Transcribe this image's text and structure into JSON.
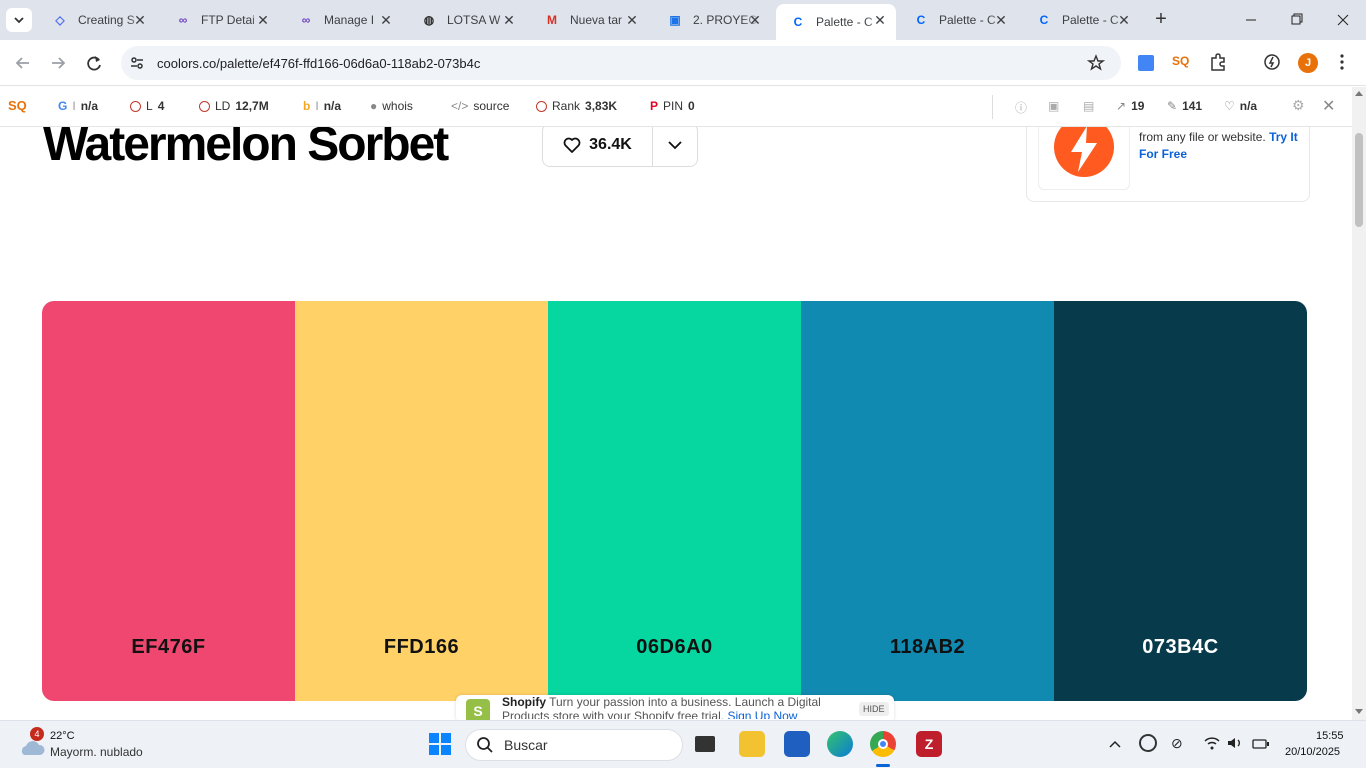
{
  "browser": {
    "tabs": [
      {
        "title": "Creating S",
        "icon": "webflow-icon",
        "color": "#4c6ef5"
      },
      {
        "title": "FTP Detai",
        "icon": "infinity-icon",
        "color": "#6f42c1"
      },
      {
        "title": "Manage I",
        "icon": "infinity-icon",
        "color": "#6f42c1"
      },
      {
        "title": "LOTSA W",
        "icon": "globe-icon",
        "color": "#333333"
      },
      {
        "title": "Nueva tar",
        "icon": "gmail-icon",
        "color": "#d93025"
      },
      {
        "title": "2. PROYEC",
        "icon": "contacts-icon",
        "color": "#1a73e8"
      },
      {
        "title": "Palette - C",
        "icon": "coolors-icon",
        "color": "#0066ff"
      },
      {
        "title": "Palette - C",
        "icon": "coolors-icon",
        "color": "#0066ff"
      },
      {
        "title": "Palette - C",
        "icon": "coolors-icon",
        "color": "#0066ff"
      }
    ],
    "url": "coolors.co/palette/ef476f-ffd166-06d6a0-118ab2-073b4c",
    "profile_initial": "J",
    "seo_badge": "SQ"
  },
  "extbar": {
    "google": "n/a",
    "links_label": "L",
    "links": "4",
    "ld_label": "LD",
    "ld": "12,7M",
    "bing": "n/a",
    "whois": "whois",
    "source": "source",
    "rank_label": "Rank",
    "rank": "3,83K",
    "pin_label": "PIN",
    "pin": "0",
    "ext_links": "19",
    "int_links": "141",
    "health": "n/a"
  },
  "page": {
    "title": "Watermelon Sorbet",
    "likes": "36.4K",
    "ad": {
      "text": "chatbot trained with your data from any file or website.",
      "cta": "Try It For Free"
    },
    "swatches": [
      {
        "hex": "EF476F",
        "color": "#EF476F",
        "text_color": "#111111"
      },
      {
        "hex": "FFD166",
        "color": "#FFD166",
        "text_color": "#111111"
      },
      {
        "hex": "06D6A0",
        "color": "#06D6A0",
        "text_color": "#111111"
      },
      {
        "hex": "118AB2",
        "color": "#118AB2",
        "text_color": "#111111"
      },
      {
        "hex": "073B4C",
        "color": "#073B4C",
        "text_color": "#ffffff"
      }
    ],
    "shopify": {
      "brand": "Shopify",
      "text": "Turn your passion into a business. Launch a Digital Products store with your Shopify free trial.",
      "cta": "Sign Up Now",
      "hide": "HIDE"
    }
  },
  "taskbar": {
    "weather_badge": "4",
    "temperature": "22°C",
    "weather": "Mayorm. nublado",
    "search_placeholder": "Buscar",
    "time": "15:55",
    "date": "20/10/2025"
  }
}
